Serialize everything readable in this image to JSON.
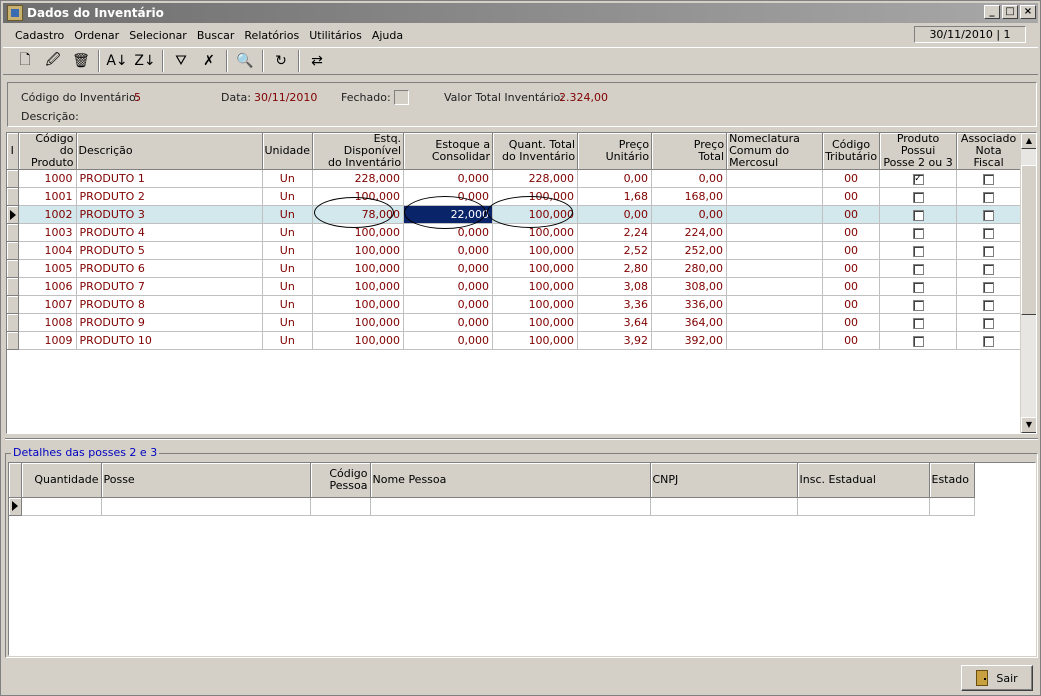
{
  "window": {
    "title": "Dados do Inventário"
  },
  "menu": [
    "Cadastro",
    "Ordenar",
    "Selecionar",
    "Buscar",
    "Relatórios",
    "Utilitários",
    "Ajuda"
  ],
  "status": {
    "date_info": "30/11/2010 | 1"
  },
  "toolbar": [
    {
      "name": "new-icon",
      "glyph": "🗋"
    },
    {
      "name": "edit-icon",
      "glyph": "🖉"
    },
    {
      "name": "delete-icon",
      "glyph": "🗑"
    },
    {
      "name": "sort-asc-icon",
      "glyph": "A↓"
    },
    {
      "name": "sort-desc-icon",
      "glyph": "Z↓"
    },
    {
      "name": "filter-icon",
      "glyph": "⛛"
    },
    {
      "name": "clear-filter-icon",
      "glyph": "✗"
    },
    {
      "name": "search-icon",
      "glyph": "🔍"
    },
    {
      "name": "refresh-icon",
      "glyph": "↻"
    },
    {
      "name": "consolidate-icon",
      "glyph": "⇄"
    }
  ],
  "header": {
    "codigo_label": "Código do Inventário:",
    "codigo_value": "5",
    "data_label": "Data:",
    "data_value": "30/11/2010",
    "fechado_label": "Fechado:",
    "valor_label": "Valor Total Inventário:",
    "valor_value": "2.324,00",
    "descricao_label": "Descrição:"
  },
  "grid": {
    "indicator_header": "I",
    "columns": [
      {
        "l1": "Código do",
        "l2": "Produto"
      },
      {
        "l1": "Descrição",
        "l2": ""
      },
      {
        "l1": "Unidade",
        "l2": ""
      },
      {
        "l1": "Estq. Disponível",
        "l2": "do Inventário"
      },
      {
        "l1": "Estoque a",
        "l2": "Consolidar"
      },
      {
        "l1": "Quant. Total",
        "l2": "do Inventário"
      },
      {
        "l1": "Preço",
        "l2": "Unitário"
      },
      {
        "l1": "Preço",
        "l2": "Total"
      },
      {
        "l1": "Nomeclatura",
        "l2": "Comum do Mercosul"
      },
      {
        "l1": "Código",
        "l2": "Tributário"
      },
      {
        "l1": "Produto Possui",
        "l2": "Posse 2 ou 3"
      },
      {
        "l1": "Associado",
        "l2": "Nota Fiscal"
      }
    ],
    "rows": [
      {
        "codigo": "1000",
        "descricao": "PRODUTO 1",
        "unidade": "Un",
        "estq": "228,000",
        "consolidar": "0,000",
        "total": "228,000",
        "preco_unit": "0,00",
        "preco_total": "0,00",
        "ncm": "",
        "trib": "00",
        "posse": true,
        "nf": false
      },
      {
        "codigo": "1001",
        "descricao": "PRODUTO 2",
        "unidade": "Un",
        "estq": "100,000",
        "consolidar": "0,000",
        "total": "100,000",
        "preco_unit": "1,68",
        "preco_total": "168,00",
        "ncm": "",
        "trib": "00",
        "posse": false,
        "nf": false
      },
      {
        "codigo": "1002",
        "descricao": "PRODUTO 3",
        "unidade": "Un",
        "estq": "78,000",
        "consolidar": "22,000",
        "total": "100,000",
        "preco_unit": "0,00",
        "preco_total": "0,00",
        "ncm": "",
        "trib": "00",
        "posse": false,
        "nf": false
      },
      {
        "codigo": "1003",
        "descricao": "PRODUTO 4",
        "unidade": "Un",
        "estq": "100,000",
        "consolidar": "0,000",
        "total": "100,000",
        "preco_unit": "2,24",
        "preco_total": "224,00",
        "ncm": "",
        "trib": "00",
        "posse": false,
        "nf": false
      },
      {
        "codigo": "1004",
        "descricao": "PRODUTO 5",
        "unidade": "Un",
        "estq": "100,000",
        "consolidar": "0,000",
        "total": "100,000",
        "preco_unit": "2,52",
        "preco_total": "252,00",
        "ncm": "",
        "trib": "00",
        "posse": false,
        "nf": false
      },
      {
        "codigo": "1005",
        "descricao": "PRODUTO 6",
        "unidade": "Un",
        "estq": "100,000",
        "consolidar": "0,000",
        "total": "100,000",
        "preco_unit": "2,80",
        "preco_total": "280,00",
        "ncm": "",
        "trib": "00",
        "posse": false,
        "nf": false
      },
      {
        "codigo": "1006",
        "descricao": "PRODUTO 7",
        "unidade": "Un",
        "estq": "100,000",
        "consolidar": "0,000",
        "total": "100,000",
        "preco_unit": "3,08",
        "preco_total": "308,00",
        "ncm": "",
        "trib": "00",
        "posse": false,
        "nf": false
      },
      {
        "codigo": "1007",
        "descricao": "PRODUTO 8",
        "unidade": "Un",
        "estq": "100,000",
        "consolidar": "0,000",
        "total": "100,000",
        "preco_unit": "3,36",
        "preco_total": "336,00",
        "ncm": "",
        "trib": "00",
        "posse": false,
        "nf": false
      },
      {
        "codigo": "1008",
        "descricao": "PRODUTO 9",
        "unidade": "Un",
        "estq": "100,000",
        "consolidar": "0,000",
        "total": "100,000",
        "preco_unit": "3,64",
        "preco_total": "364,00",
        "ncm": "",
        "trib": "00",
        "posse": false,
        "nf": false
      },
      {
        "codigo": "1009",
        "descricao": "PRODUTO 10",
        "unidade": "Un",
        "estq": "100,000",
        "consolidar": "0,000",
        "total": "100,000",
        "preco_unit": "3,92",
        "preco_total": "392,00",
        "ncm": "",
        "trib": "00",
        "posse": false,
        "nf": false
      }
    ]
  },
  "details": {
    "title": "Detalhes das posses 2 e 3",
    "columns": [
      {
        "l1": "Quantidade",
        "l2": ""
      },
      {
        "l1": "Posse",
        "l2": ""
      },
      {
        "l1": "Código",
        "l2": "Pessoa"
      },
      {
        "l1": "Nome Pessoa",
        "l2": ""
      },
      {
        "l1": "CNPJ",
        "l2": ""
      },
      {
        "l1": "Insc. Estadual",
        "l2": ""
      },
      {
        "l1": "Estado",
        "l2": ""
      }
    ]
  },
  "buttons": {
    "sair": "Sair"
  }
}
